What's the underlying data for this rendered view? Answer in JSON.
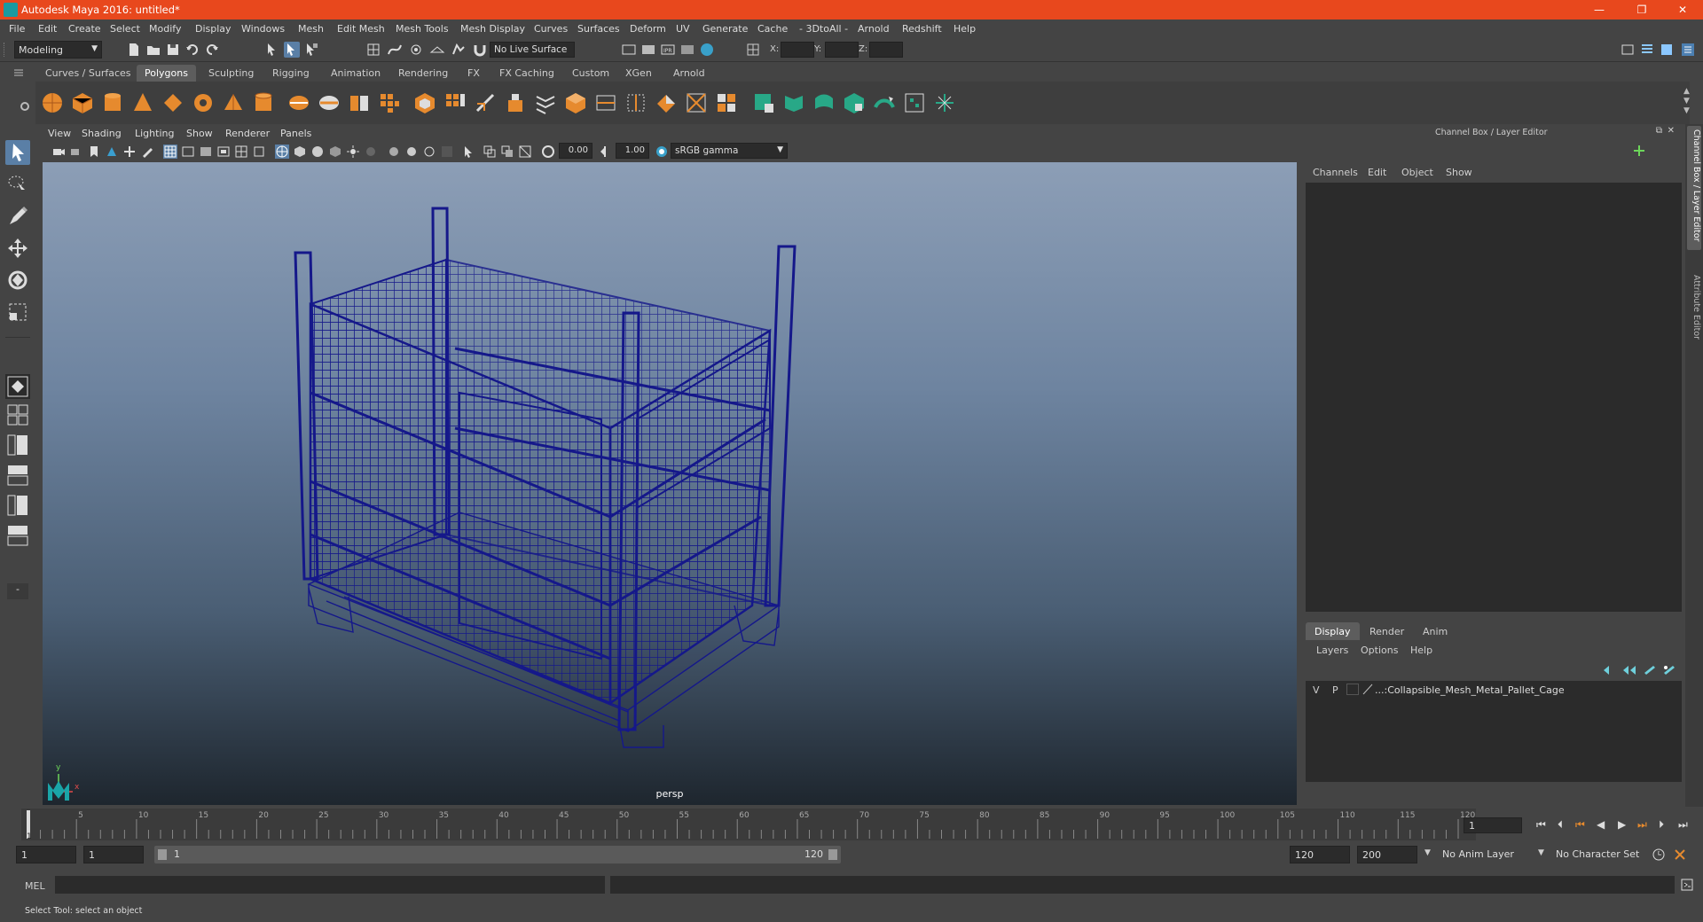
{
  "window": {
    "title": "Autodesk Maya 2016: untitled*",
    "controls": [
      "—",
      "❐",
      "✕"
    ]
  },
  "menubar": [
    "File",
    "Edit",
    "Create",
    "Select",
    "Modify",
    "Display",
    "Windows",
    "Mesh",
    "Edit Mesh",
    "Mesh Tools",
    "Mesh Display",
    "Curves",
    "Surfaces",
    "Deform",
    "UV",
    "Generate",
    "Cache",
    "- 3DtoAll -",
    "Arnold",
    "Redshift",
    "Help"
  ],
  "statusline": {
    "mode": "Modeling",
    "live_surface": "No Live Surface",
    "x_label": "X:",
    "y_label": "Y:",
    "z_label": "Z:"
  },
  "shelf_tabs": [
    "Curves / Surfaces",
    "Polygons",
    "Sculpting",
    "Rigging",
    "Animation",
    "Rendering",
    "FX",
    "FX Caching",
    "Custom",
    "XGen",
    "Arnold"
  ],
  "active_shelf": "Polygons",
  "viewport": {
    "menus": [
      "View",
      "Shading",
      "Lighting",
      "Show",
      "Renderer",
      "Panels"
    ],
    "exposure": "0.00",
    "gamma": "1.00",
    "color_space": "sRGB gamma",
    "camera_label": "persp",
    "axis_x": "x",
    "axis_y": "y"
  },
  "channel_box": {
    "header": "Channel Box / Layer Editor",
    "menus": [
      "Channels",
      "Edit",
      "Object",
      "Show"
    ],
    "side_tabs": [
      "Channel Box / Layer Editor",
      "Attribute Editor"
    ]
  },
  "layer_editor": {
    "tabs": [
      "Display",
      "Render",
      "Anim"
    ],
    "active_tab": "Display",
    "menus": [
      "Layers",
      "Options",
      "Help"
    ],
    "layers": [
      {
        "v": "V",
        "p": "P",
        "name": "...:Collapsible_Mesh_Metal_Pallet_Cage"
      }
    ]
  },
  "timeline": {
    "ticks": [
      "5",
      "10",
      "15",
      "20",
      "25",
      "30",
      "35",
      "40",
      "45",
      "50",
      "55",
      "60",
      "65",
      "70",
      "75",
      "80",
      "85",
      "90",
      "95",
      "100",
      "105",
      "110",
      "115",
      "120"
    ],
    "start_marker": "1",
    "current_frame": "1"
  },
  "range": {
    "start": "1",
    "playback_start": "1",
    "slider_start": "1",
    "slider_end": "120",
    "playback_end": "120",
    "end": "200",
    "anim_layer": "No Anim Layer",
    "character_set": "No Character Set"
  },
  "command_line": {
    "label": "MEL"
  },
  "help_line": "Select Tool: select an object"
}
